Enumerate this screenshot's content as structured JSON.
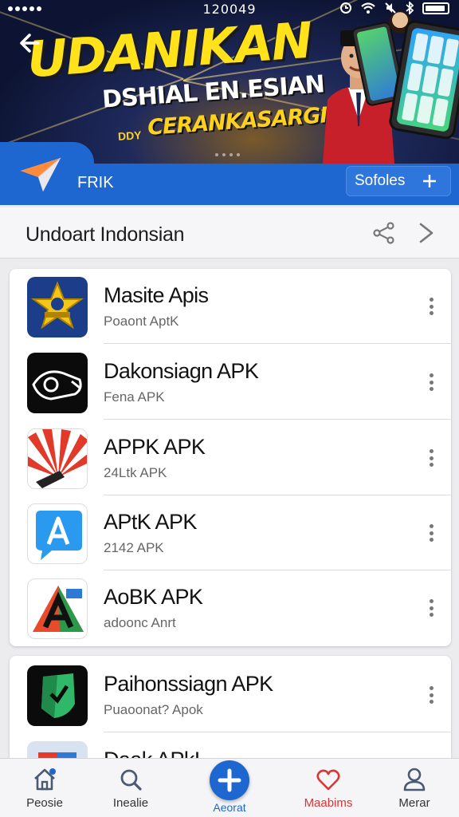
{
  "status_bar": {
    "time": "120049"
  },
  "banner": {
    "title": "UDANIKAN",
    "subtitle_line1": "DSHIAL EN.ESIAN",
    "subtitle_line2": "CERANKASARGIAI",
    "subtitle_small": "DDY"
  },
  "toolbar": {
    "label": "FRIK",
    "sort_label": "Sofoles"
  },
  "section": {
    "title": "Undoart Indonsian"
  },
  "apps": [
    {
      "name": "Masite Apis",
      "sub": "Poaont AptK",
      "icon": "star-badge-icon"
    },
    {
      "name": "Dakonsiagn APK",
      "sub": "Fena APK",
      "icon": "fish-outline-icon"
    },
    {
      "name": "APPK APK",
      "sub": "24Ltk APK",
      "icon": "sunburst-icon"
    },
    {
      "name": "APtK APK",
      "sub": "2142 APK",
      "icon": "blue-a-icon"
    },
    {
      "name": "AoBK APK",
      "sub": "adoonc Anrt",
      "icon": "triangle-a-icon"
    }
  ],
  "apps_more": [
    {
      "name": "Paihonssiagn APK",
      "sub": "Puaoonat? Apok",
      "icon": "green-shield-icon"
    },
    {
      "name": "Daak APkI",
      "sub": "",
      "icon": "colorful-tile-icon"
    }
  ],
  "bottom_nav": [
    {
      "label": "Peosie",
      "icon": "home-icon"
    },
    {
      "label": "Inealie",
      "icon": "search-icon"
    },
    {
      "label": "Aeorat",
      "icon": "add-icon"
    },
    {
      "label": "Maabims",
      "icon": "heart-icon"
    },
    {
      "label": "Merar",
      "icon": "profile-icon"
    }
  ],
  "colors": {
    "primary": "#1e66d0",
    "banner_yellow": "#ffe21a",
    "favorite_red": "#d33333"
  }
}
